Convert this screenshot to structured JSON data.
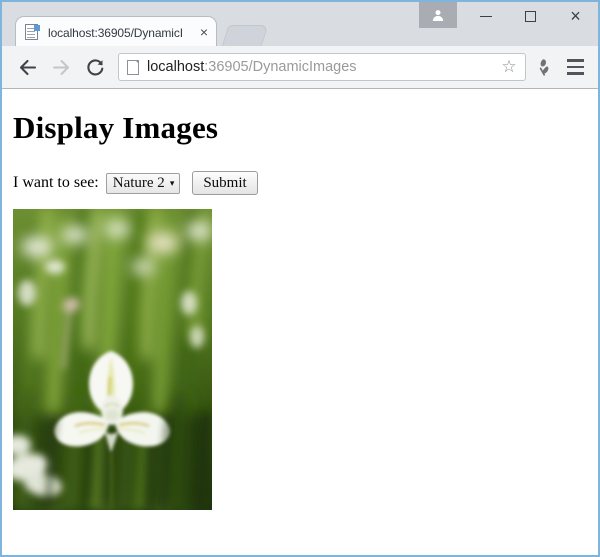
{
  "browser": {
    "tab": {
      "title": "localhost:36905/DynamicI",
      "favicon_name": "page-favicon",
      "close_label": "×"
    },
    "new_tab_label": "",
    "window_controls": {
      "avatar_label": "὆4",
      "minimize_label": "",
      "maximize_label": "",
      "close_label": "×"
    },
    "toolbar": {
      "back_label": "←",
      "forward_label": "→",
      "reload_label": "⟳",
      "url_host": "localhost",
      "url_rest": ":36905/DynamicImages",
      "url_full": "localhost:36905/DynamicImages",
      "bookmark_label": "☆",
      "extension_name": "extension-icon",
      "menu_name": "menu-icon"
    }
  },
  "page": {
    "title": "Display Images",
    "form": {
      "label": "I want to see:",
      "select_value": "Nature 2",
      "select_arrow": "▾",
      "select_options": [
        "Nature 2"
      ],
      "submit_label": "Submit"
    },
    "image": {
      "alt": "Nature 2",
      "description": "White iris flower in blurred green foliage",
      "width": "199",
      "height": "301"
    }
  },
  "colors": {
    "tab_strip": "#d9dde2",
    "window_border": "#7fb4dd",
    "toolbar": "#f2f3f4",
    "page_background": "#ffffff",
    "foliage_dark": "#2d4214",
    "foliage_mid": "#4f7a1e",
    "foliage_light": "#9cc24a",
    "petal_white": "#f6f7f2",
    "petal_yellow": "#d9c64a"
  }
}
